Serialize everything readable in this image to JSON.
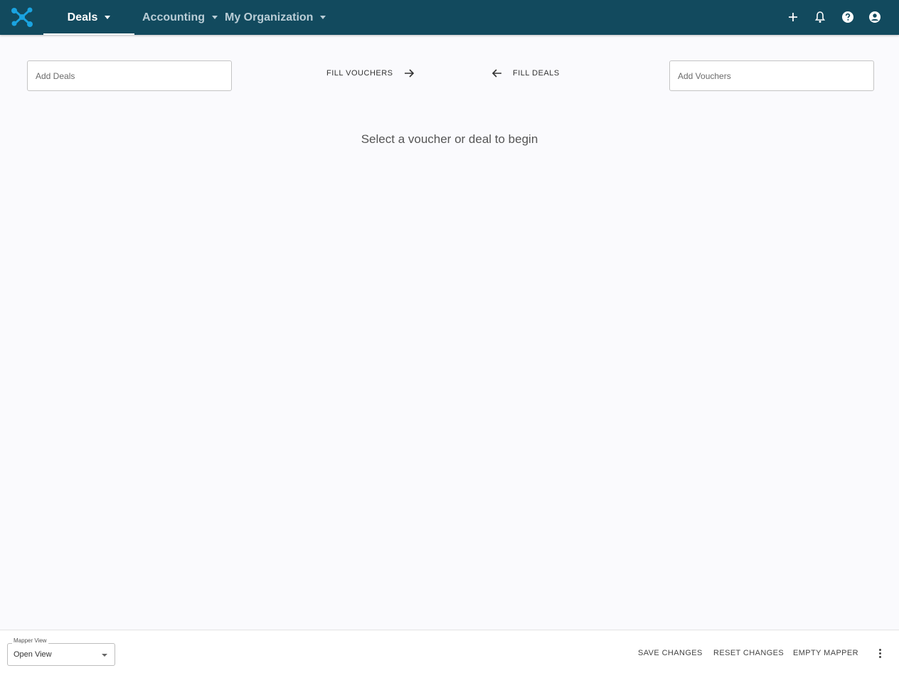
{
  "nav": {
    "items": [
      {
        "label": "Deals",
        "active": true
      },
      {
        "label": "Accounting",
        "active": false
      },
      {
        "label": "My Organization",
        "active": false
      }
    ],
    "icons": [
      "plus-icon",
      "bell-icon",
      "help-icon",
      "account-circle-icon"
    ]
  },
  "mapper": {
    "deals_input": {
      "placeholder": "Add Deals",
      "value": ""
    },
    "vouchers_input": {
      "placeholder": "Add Vouchers",
      "value": ""
    },
    "fill_vouchers_label": "FILL VOUCHERS",
    "fill_deals_label": "FILL DEALS",
    "empty_message": "Select a voucher or deal to begin"
  },
  "footer": {
    "view_select": {
      "label": "Mapper View",
      "value": "Open View"
    },
    "save_label": "SAVE CHANGES",
    "reset_label": "RESET CHANGES",
    "empty_label": "EMPTY MAPPER"
  },
  "colors": {
    "header_bg": "#124a5e",
    "page_bg": "#fafafd",
    "logo_accent": "#1aa3e0"
  }
}
